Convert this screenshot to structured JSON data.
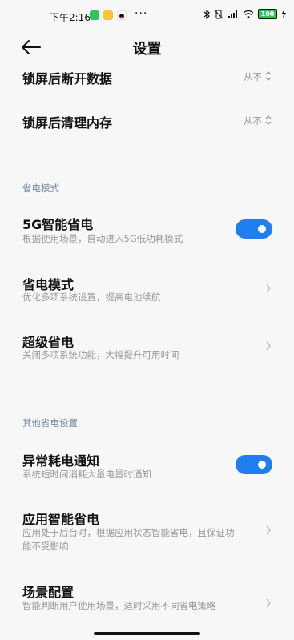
{
  "status_bar": {
    "time": "下午2:16",
    "dots": "···",
    "battery": "100"
  },
  "header": {
    "title": "设置"
  },
  "rows_top": [
    {
      "title": "锁屏后断开数据",
      "value": "从不"
    },
    {
      "title": "锁屏后清理内存",
      "value": "从不"
    }
  ],
  "section_power": {
    "label": "省电模式",
    "items": [
      {
        "title": "5G智能省电",
        "desc": "根据使用场景，自动进入5G低功耗模式",
        "toggle": true
      },
      {
        "title": "省电模式",
        "desc": "优化多项系统设置，提高电池续航"
      },
      {
        "title": "超级省电",
        "desc": "关闭多项系统功能，大幅提升可用时间"
      }
    ]
  },
  "section_other": {
    "label": "其他省电设置",
    "items": [
      {
        "title": "异常耗电通知",
        "desc": "系统短时间消耗大量电量时通知",
        "toggle": true
      },
      {
        "title": "应用智能省电",
        "desc": "应用处于后台时，根据应用状态智能省电，且保证功能不受影响"
      },
      {
        "title": "场景配置",
        "desc": "智能判断用户使用场景，适时采用不同省电策略"
      }
    ]
  },
  "colors": {
    "accent": "#1f7ef0",
    "background": "#f7f7f7",
    "secondary_text": "#999999",
    "section_text": "#7a8aa8"
  }
}
